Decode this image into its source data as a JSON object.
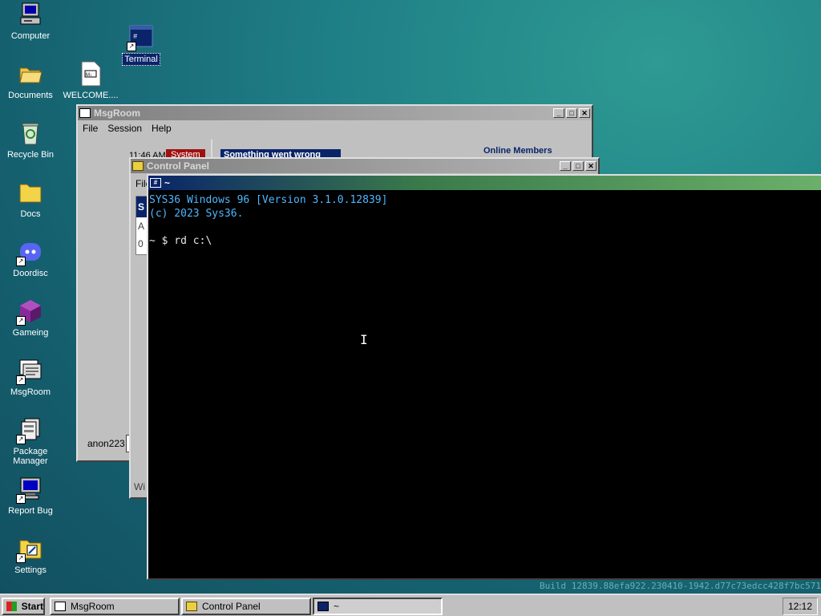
{
  "desktop": {
    "icons": [
      {
        "label": "Computer"
      },
      {
        "label": "Terminal"
      },
      {
        "label": "Documents"
      },
      {
        "label": "WELCOME...."
      },
      {
        "label": "Recycle Bin"
      },
      {
        "label": "Docs"
      },
      {
        "label": "Doordisc"
      },
      {
        "label": "Gameing"
      },
      {
        "label": "MsgRoom"
      },
      {
        "label": "Package Manager"
      },
      {
        "label": "Report Bug"
      },
      {
        "label": "Settings"
      }
    ],
    "build_string": "Build 12839.88efa922.230410-1942.d77c73edcc428f7bc571"
  },
  "msgroom": {
    "title": "MsgRoom",
    "menu": [
      "File",
      "Session",
      "Help"
    ],
    "message_time": "11:46 AM",
    "message_badge": "System",
    "message_text": "Something went wrong",
    "online_members_label": "Online Members",
    "username": "anon223"
  },
  "control_panel": {
    "title": "Control Panel",
    "menu_partial": "File",
    "side_letters": [
      "S",
      "A",
      "0"
    ],
    "status_partial": "Wi"
  },
  "terminal": {
    "title": "~",
    "lines": [
      "SYS36 Windows 96 [Version 3.1.0.12839]",
      "(c) 2023 Sys36.",
      "",
      "~ $ rd c:\\"
    ]
  },
  "taskbar": {
    "start_label": "Start",
    "buttons": [
      {
        "label": "MsgRoom"
      },
      {
        "label": "Control Panel"
      },
      {
        "label": "~"
      }
    ],
    "clock": "12:12"
  },
  "colors": {
    "terminal_text": "#4fb6ff",
    "terminal_prompt": "#e8e8e8",
    "system_badge": "#a01010",
    "selection": "#0a246a"
  }
}
